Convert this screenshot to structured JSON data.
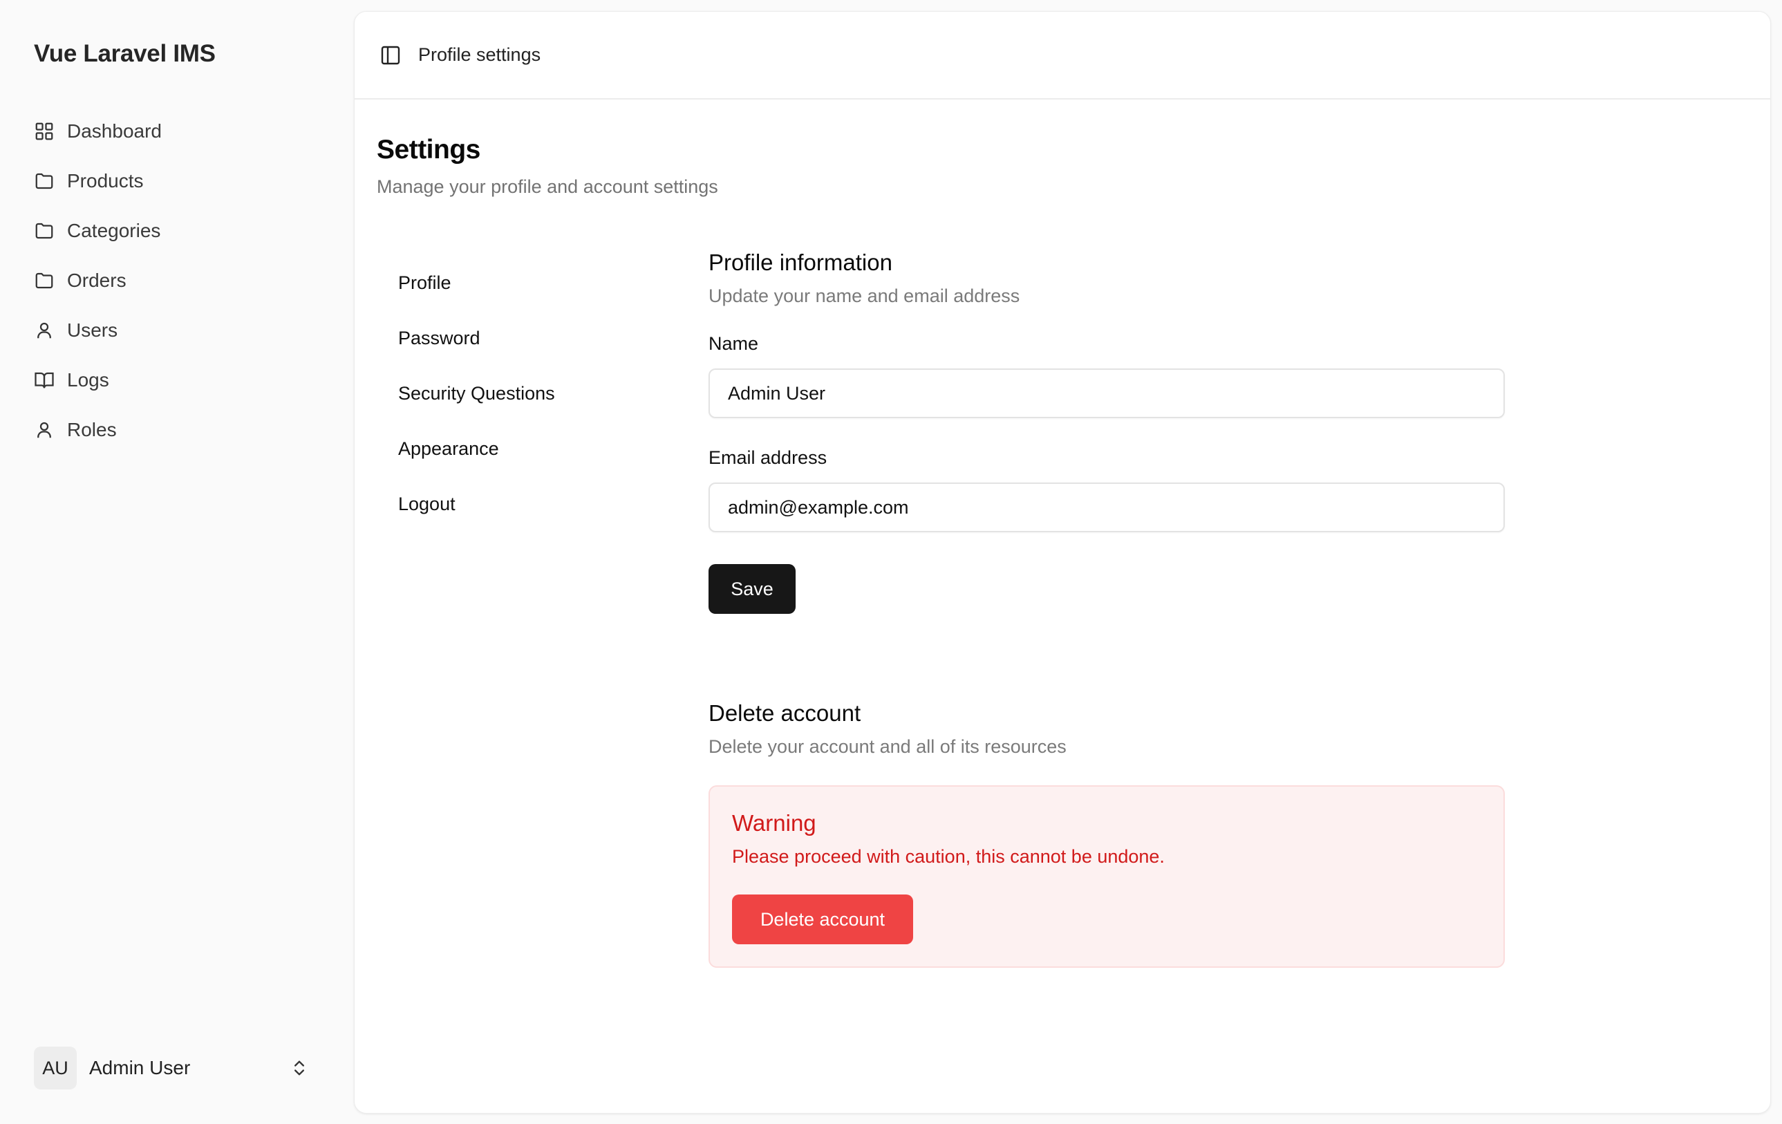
{
  "app": {
    "title": "Vue Laravel IMS"
  },
  "sidebar": {
    "items": [
      {
        "label": "Dashboard",
        "icon": "grid-icon"
      },
      {
        "label": "Products",
        "icon": "folder-icon"
      },
      {
        "label": "Categories",
        "icon": "folder-icon"
      },
      {
        "label": "Orders",
        "icon": "folder-icon"
      },
      {
        "label": "Users",
        "icon": "user-icon"
      },
      {
        "label": "Logs",
        "icon": "book-open-icon"
      },
      {
        "label": "Roles",
        "icon": "user-icon"
      }
    ],
    "user": {
      "initials": "AU",
      "name": "Admin User"
    }
  },
  "header": {
    "breadcrumb": "Profile settings"
  },
  "page": {
    "title": "Settings",
    "subtitle": "Manage your profile and account settings"
  },
  "settings_nav": [
    "Profile",
    "Password",
    "Security Questions",
    "Appearance",
    "Logout"
  ],
  "profile": {
    "title": "Profile information",
    "description": "Update your name and email address",
    "name_label": "Name",
    "name_value": "Admin User",
    "email_label": "Email address",
    "email_value": "admin@example.com",
    "save_label": "Save"
  },
  "delete": {
    "title": "Delete account",
    "description": "Delete your account and all of its resources",
    "warning_title": "Warning",
    "warning_text": "Please proceed with caution, this cannot be undone.",
    "button_label": "Delete account"
  },
  "colors": {
    "accent_dark": "#171717",
    "danger": "#ef4444",
    "danger_text": "#d11a1a",
    "danger_bg": "#fdf1f1"
  }
}
